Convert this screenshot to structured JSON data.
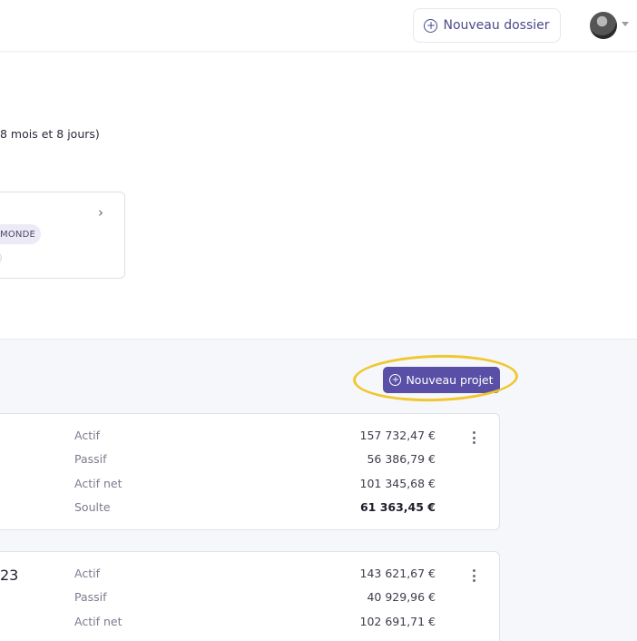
{
  "header": {
    "new_folder_label": "Nouveau dossier"
  },
  "case": {
    "duration_text": "8 mois et 8 jours)",
    "badge_text": "MONDE"
  },
  "projects": {
    "new_project_label": "Nouveau projet",
    "cards": [
      {
        "title_fragment": "",
        "rows": [
          {
            "label": "Actif",
            "value": "157 732,47 €",
            "bold": false
          },
          {
            "label": "Passif",
            "value": "56 386,79 €",
            "bold": false
          },
          {
            "label": "Actif net",
            "value": "101 345,68 €",
            "bold": false
          },
          {
            "label": "Soulte",
            "value": "61 363,45 €",
            "bold": true
          }
        ]
      },
      {
        "title_fragment": "23",
        "rows": [
          {
            "label": "Actif",
            "value": "143 621,67 €",
            "bold": false
          },
          {
            "label": "Passif",
            "value": "40 929,96 €",
            "bold": false
          },
          {
            "label": "Actif net",
            "value": "102 691,71 €",
            "bold": false
          }
        ]
      }
    ]
  },
  "colors": {
    "primary": "#5a4fa6",
    "highlight": "#f0c72e",
    "page_bg": "#f6f7fa"
  }
}
